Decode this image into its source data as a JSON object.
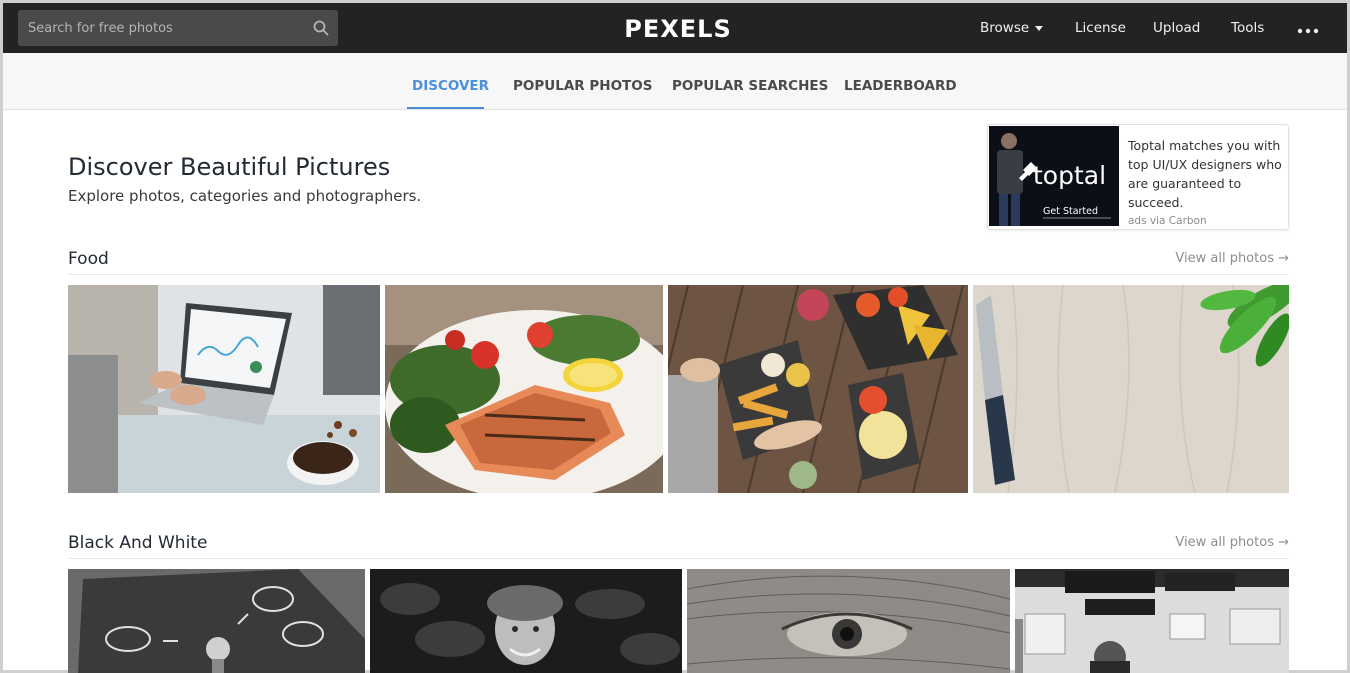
{
  "header": {
    "search_placeholder": "Search for free photos",
    "logo": "PEXELS",
    "nav": {
      "browse": "Browse",
      "license": "License",
      "upload": "Upload",
      "tools": "Tools"
    },
    "icons": {
      "search": "search-icon",
      "more": "more-dots-icon",
      "browse_caret": "caret-down-icon"
    }
  },
  "subnav": {
    "tabs": [
      "DISCOVER",
      "POPULAR PHOTOS",
      "POPULAR SEARCHES",
      "LEADERBOARD"
    ],
    "active_tab": "DISCOVER",
    "active_color": "#4a90d9"
  },
  "hero": {
    "title": "Discover Beautiful Pictures",
    "subtitle": "Explore photos, categories and photographers."
  },
  "ad": {
    "brand": "toptal",
    "cta": "Get Started",
    "text": "Toptal matches you with top UI/UX designers who are guaranteed to succeed.",
    "via": "ads via Carbon"
  },
  "sections": [
    {
      "title": "Food",
      "view_all": "View all photos →"
    },
    {
      "title": "Black And White",
      "view_all": "View all photos →"
    }
  ]
}
